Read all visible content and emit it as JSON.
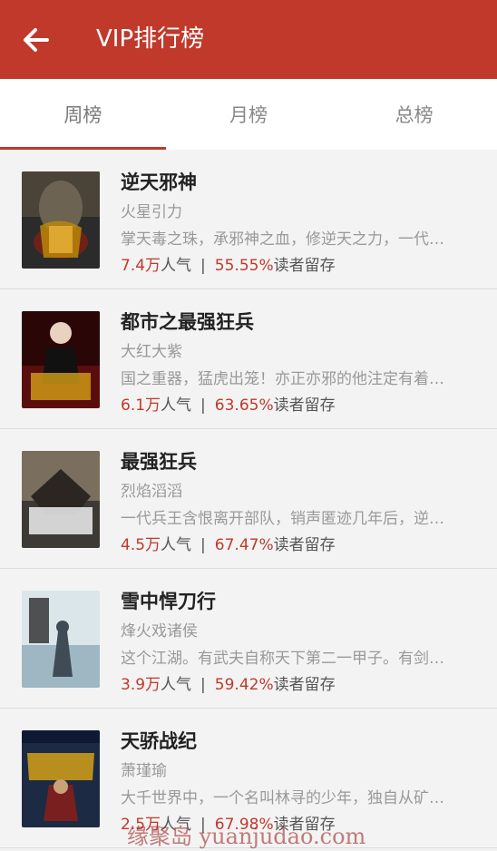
{
  "header": {
    "title": "VIP排行榜"
  },
  "tabs": [
    {
      "label": "周榜"
    },
    {
      "label": "月榜"
    },
    {
      "label": "总榜"
    }
  ],
  "books": [
    {
      "title": "逆天邪神",
      "author": "火星引力",
      "desc": "掌天毒之珠，承邪神之血，修逆天之力，一代…",
      "popularity": "7.4万",
      "pop_suffix": "人气",
      "retention": "55.55%",
      "ret_suffix": "读者留存"
    },
    {
      "title": "都市之最强狂兵",
      "author": "大红大紫",
      "desc": "国之重器，猛虎出笼！亦正亦邪的他注定有着…",
      "popularity": "6.1万",
      "pop_suffix": "人气",
      "retention": "63.65%",
      "ret_suffix": "读者留存"
    },
    {
      "title": "最强狂兵",
      "author": "烈焰滔滔",
      "desc": "一代兵王含恨离开部队，销声匿迹几年后，逆…",
      "popularity": "4.5万",
      "pop_suffix": "人气",
      "retention": "67.47%",
      "ret_suffix": "读者留存"
    },
    {
      "title": "雪中悍刀行",
      "author": "烽火戏诸侯",
      "desc": "这个江湖。有武夫自称天下第二一甲子。有剑…",
      "popularity": "3.9万",
      "pop_suffix": "人气",
      "retention": "59.42%",
      "ret_suffix": "读者留存"
    },
    {
      "title": "天骄战纪",
      "author": "萧瑾瑜",
      "desc": "大千世界中，一个名叫林寻的少年，独自从矿…",
      "popularity": "2.5万",
      "pop_suffix": "人气",
      "retention": "67.98%",
      "ret_suffix": "读者留存"
    }
  ],
  "separator": "|",
  "watermark": "缘聚岛 yuanjudao.com",
  "colors": {
    "brand": "#c0392b",
    "background": "#f3f3f3"
  }
}
